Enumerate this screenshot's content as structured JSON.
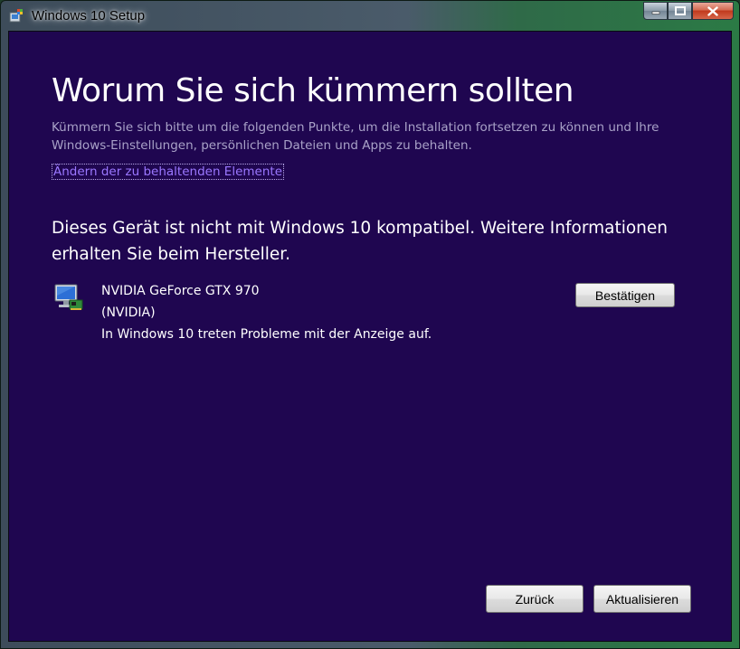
{
  "window": {
    "title": "Windows 10 Setup",
    "icon": "windows-setup-icon"
  },
  "page": {
    "heading": "Worum Sie sich kümmern sollten",
    "subtitle": "Kümmern Sie sich bitte um die folgenden Punkte, um die Installation fortsetzen zu können und Ihre Windows-Einstellungen, persönlichen Dateien und Apps zu behalten.",
    "change_link": "Ändern der zu behaltenden Elemente",
    "compat_message": "Dieses Gerät ist nicht mit Windows 10 kompatibel. Weitere Informationen erhalten Sie beim Hersteller."
  },
  "device": {
    "name": "NVIDIA GeForce GTX 970",
    "vendor": "(NVIDIA)",
    "issue": "In Windows 10 treten Probleme mit der Anzeige auf.",
    "icon": "display-adapter-icon",
    "confirm_label": "Bestätigen"
  },
  "footer": {
    "back_label": "Zurück",
    "update_label": "Aktualisieren"
  },
  "colors": {
    "background": "#1f0650",
    "link": "#9b78ff",
    "subtitle": "#a9a2c8"
  }
}
